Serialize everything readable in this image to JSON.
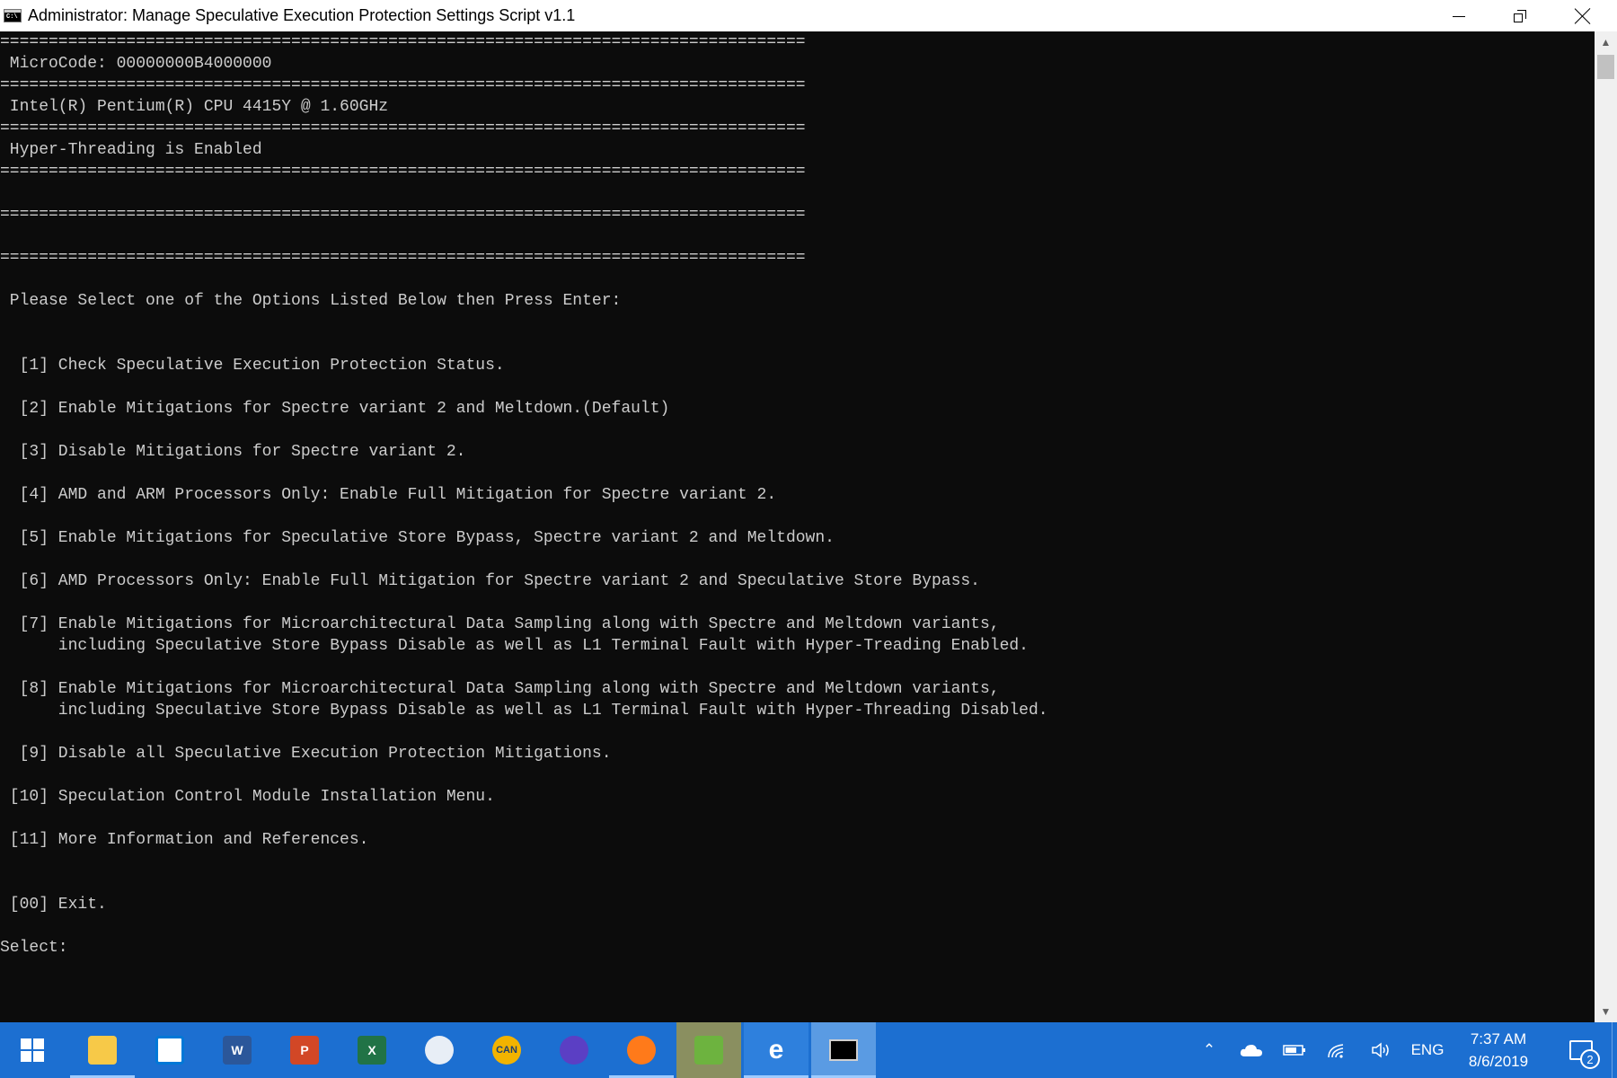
{
  "window": {
    "title": "Administrator:  Manage Speculative Execution Protection Settings Script v1.1",
    "icon_text": "C:\\"
  },
  "console": {
    "lines": [
      "===================================================================================",
      " MicroCode: 00000000B4000000",
      "===================================================================================",
      " Intel(R) Pentium(R) CPU 4415Y @ 1.60GHz",
      "===================================================================================",
      " Hyper-Threading is Enabled",
      "===================================================================================",
      "",
      "===================================================================================",
      "",
      "===================================================================================",
      "",
      " Please Select one of the Options Listed Below then Press Enter:",
      "",
      "",
      "  [1] Check Speculative Execution Protection Status.",
      "",
      "  [2] Enable Mitigations for Spectre variant 2 and Meltdown.(Default)",
      "",
      "  [3] Disable Mitigations for Spectre variant 2.",
      "",
      "  [4] AMD and ARM Processors Only: Enable Full Mitigation for Spectre variant 2.",
      "",
      "  [5] Enable Mitigations for Speculative Store Bypass, Spectre variant 2 and Meltdown.",
      "",
      "  [6] AMD Processors Only: Enable Full Mitigation for Spectre variant 2 and Speculative Store Bypass.",
      "",
      "  [7] Enable Mitigations for Microarchitectural Data Sampling along with Spectre and Meltdown variants,",
      "      including Speculative Store Bypass Disable as well as L1 Terminal Fault with Hyper-Treading Enabled.",
      "",
      "  [8] Enable Mitigations for Microarchitectural Data Sampling along with Spectre and Meltdown variants,",
      "      including Speculative Store Bypass Disable as well as L1 Terminal Fault with Hyper-Threading Disabled.",
      "",
      "  [9] Disable all Speculative Execution Protection Mitigations.",
      "",
      " [10] Speculation Control Module Installation Menu.",
      "",
      " [11] More Information and References.",
      "",
      "",
      " [00] Exit.",
      "",
      "Select:"
    ]
  },
  "taskbar": {
    "apps": [
      {
        "name": "file-explorer",
        "icon": "folder-icon",
        "color": "#f7c948",
        "label": ""
      },
      {
        "name": "microsoft-store",
        "icon": "store-icon",
        "color": "#ffffff",
        "label": ""
      },
      {
        "name": "word",
        "icon": "word-icon",
        "color": "#2b579a",
        "label": "W"
      },
      {
        "name": "powerpoint",
        "icon": "powerpoint-icon",
        "color": "#d24726",
        "label": "P"
      },
      {
        "name": "excel",
        "icon": "excel-icon",
        "color": "#217346",
        "label": "X"
      },
      {
        "name": "cloud-app",
        "icon": "cloud-icon",
        "color": "#e8eef6",
        "label": ""
      },
      {
        "name": "edge-canary",
        "icon": "edge-canary-icon",
        "color": "#f2b300",
        "label": "CAN"
      },
      {
        "name": "firefox-nightly",
        "icon": "firefox-nightly-icon",
        "color": "#5b3fc4",
        "label": ""
      },
      {
        "name": "firefox",
        "icon": "firefox-icon",
        "color": "#ff7a1a",
        "label": ""
      },
      {
        "name": "feed-reader",
        "icon": "rss-icon",
        "color": "#6db33f",
        "label": ""
      },
      {
        "name": "edge",
        "icon": "edge-icon",
        "color": "#0078d7",
        "label": "e"
      },
      {
        "name": "command-prompt",
        "icon": "cmd-icon",
        "color": "#000000",
        "label": ""
      }
    ],
    "language": "ENG",
    "time": "7:37 AM",
    "date": "8/6/2019",
    "notification_count": "2"
  },
  "colors": {
    "console_bg": "#0c0c0c",
    "console_fg": "#cccccc",
    "taskbar_bg": "#1c6fd1"
  }
}
